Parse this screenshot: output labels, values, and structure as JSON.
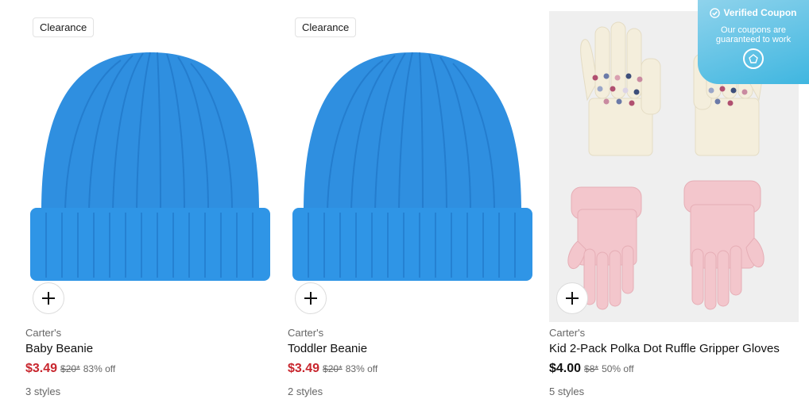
{
  "products": [
    {
      "badge": "Clearance",
      "brand": "Carter's",
      "title": "Baby Beanie",
      "price": "$3.49",
      "original_price": "$20*",
      "discount": "83% off",
      "styles": "3 styles",
      "image": "blue-knit-beanie"
    },
    {
      "badge": "Clearance",
      "brand": "Carter's",
      "title": "Toddler Beanie",
      "price": "$3.49",
      "original_price": "$20*",
      "discount": "83% off",
      "styles": "2 styles",
      "image": "blue-knit-beanie"
    },
    {
      "brand": "Carter's",
      "title": "Kid 2-Pack Polka Dot Ruffle Gripper Gloves",
      "price": "$4.00",
      "original_price": "$8*",
      "discount": "50% off",
      "styles": "5 styles",
      "image": "gloves-two-pack"
    }
  ],
  "coupon": {
    "title": "Verified Coupon",
    "message": "Our coupons are guaranteed to work",
    "icon": "shield-check-icon"
  },
  "colors": {
    "sale_price": "#c8262e",
    "beanie_blue": "#2f8fe0",
    "coupon_gradient_start": "#8fd3ec",
    "coupon_gradient_end": "#3fb6e0"
  },
  "icons": {
    "add": "plus-icon"
  }
}
